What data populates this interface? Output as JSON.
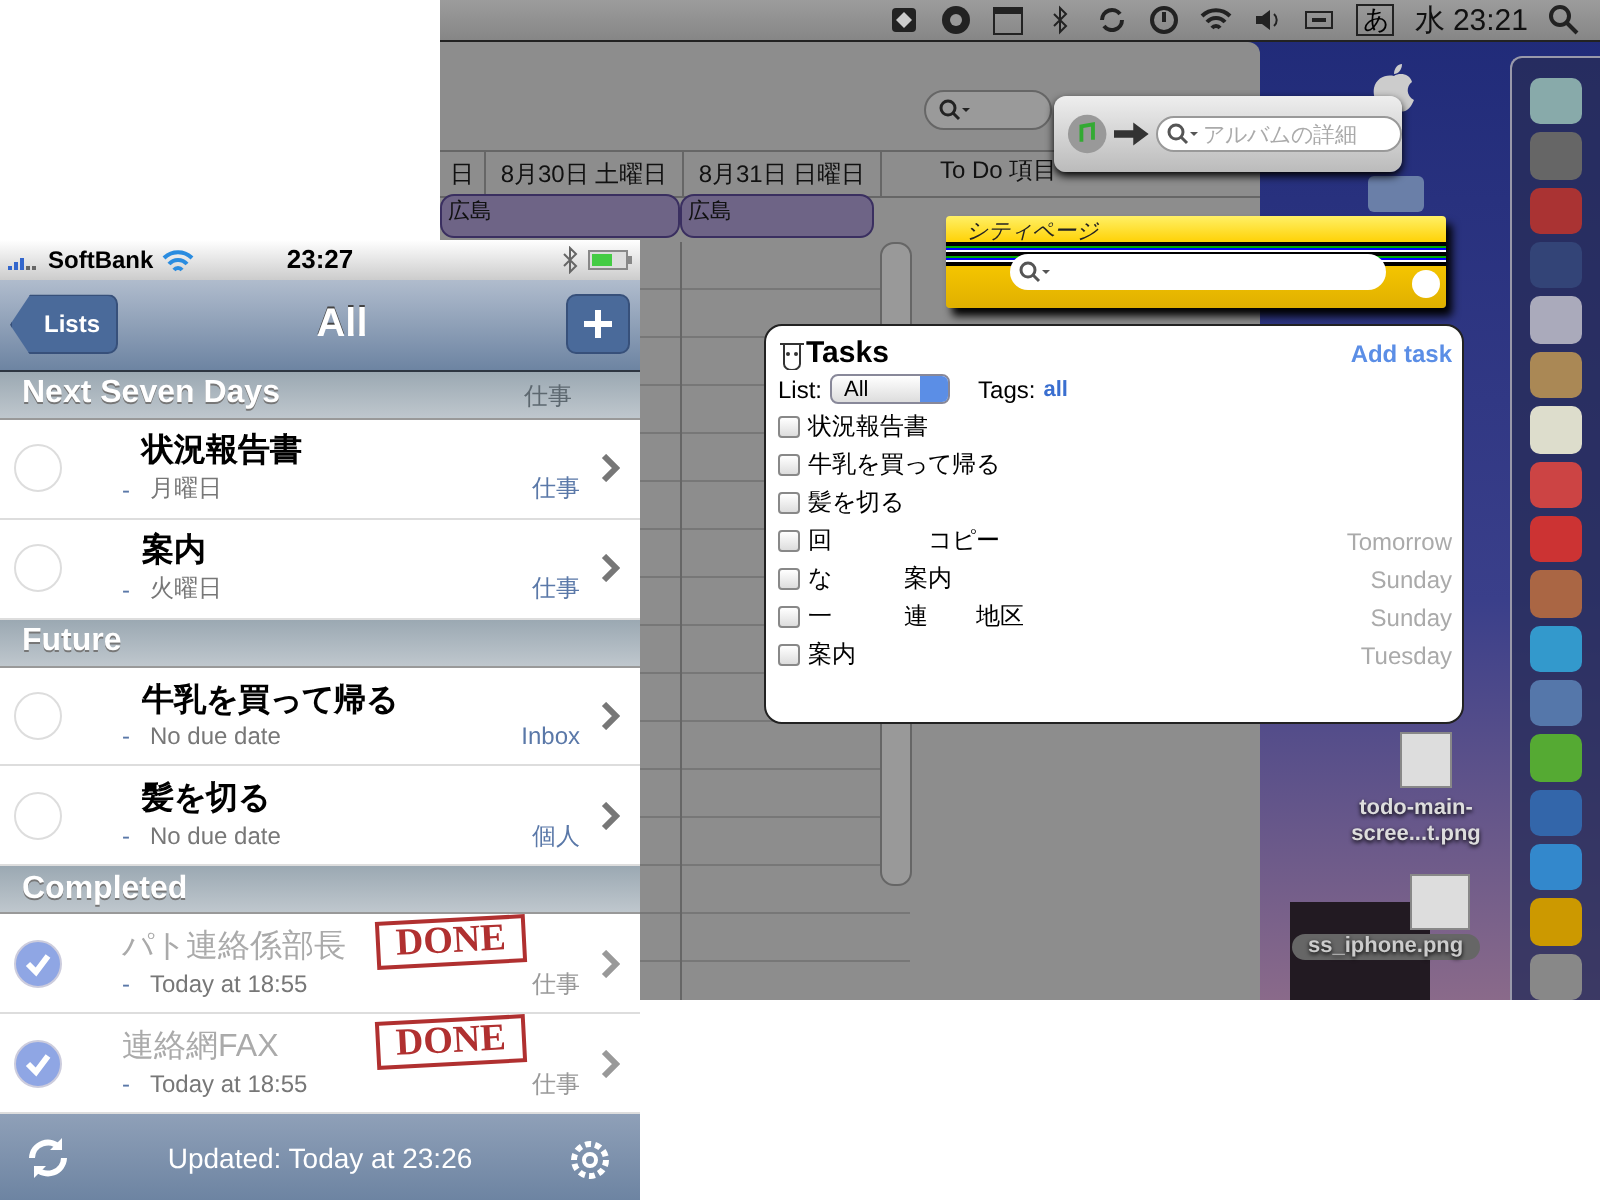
{
  "menu_bar": {
    "input_method": "あ",
    "clock": "水 23:21"
  },
  "calendar": {
    "day_headers": [
      "日",
      "8月30日 土曜日",
      "8月31日 日曜日"
    ],
    "events": [
      "広島",
      "広島"
    ],
    "todo_header": "To Do 項目"
  },
  "itunes_widget": {
    "placeholder": "アルバムの詳細"
  },
  "citypage_widget": {
    "title": "シティページ"
  },
  "tasks_widget": {
    "title": "Tasks",
    "add": "Add task",
    "list_label": "List:",
    "list_value": "All",
    "tags_label": "Tags:",
    "tags_value": "all",
    "tasks": [
      {
        "text": "状況報告書",
        "checked": false
      },
      {
        "text": "牛乳を買って帰る",
        "checked": false
      },
      {
        "text": "髪を切る",
        "checked": false
      },
      {
        "text": "回　　　　コピー",
        "due": "Tomorrow",
        "checked": false
      },
      {
        "text": "な　　　案内",
        "due": "Sunday",
        "checked": false
      },
      {
        "text": "一　　　連　　地区",
        "due": "Sunday",
        "checked": false
      },
      {
        "text": "案内",
        "due": "Tuesday",
        "checked": false
      }
    ]
  },
  "desktop_files": [
    "todo-main-scree...t.png",
    "ss_iphone.png"
  ],
  "iphone": {
    "carrier": "SoftBank",
    "time": "23:27",
    "back": "Lists",
    "title": "All",
    "sections": [
      {
        "title": "Next Seven Days",
        "underlay_tag": "仕事",
        "rows": [
          {
            "title": "状況報告書",
            "bullet": "-",
            "date": "月曜日",
            "list": "仕事",
            "done": false
          },
          {
            "title": "案内",
            "bullet": "-",
            "date": "火曜日",
            "list": "仕事",
            "done": false
          }
        ]
      },
      {
        "title": "Future",
        "rows": [
          {
            "title": "牛乳を買って帰る",
            "bullet": "-",
            "date": "No due date",
            "list": "Inbox",
            "done": false
          },
          {
            "title": "髪を切る",
            "bullet": "-",
            "date": "No due date",
            "list": "個人",
            "done": false
          }
        ]
      },
      {
        "title": "Completed",
        "rows": [
          {
            "title": "パト連絡係部長",
            "bullet": "-",
            "date": "Today at 18:55",
            "list": "仕事",
            "done": true,
            "stamp": "DONE"
          },
          {
            "title": "連絡網FAX",
            "bullet": "-",
            "date": "Today at 18:55",
            "list": "仕事",
            "done": true,
            "stamp": "DONE"
          }
        ]
      }
    ],
    "status": "Updated: Today at 23:26"
  }
}
